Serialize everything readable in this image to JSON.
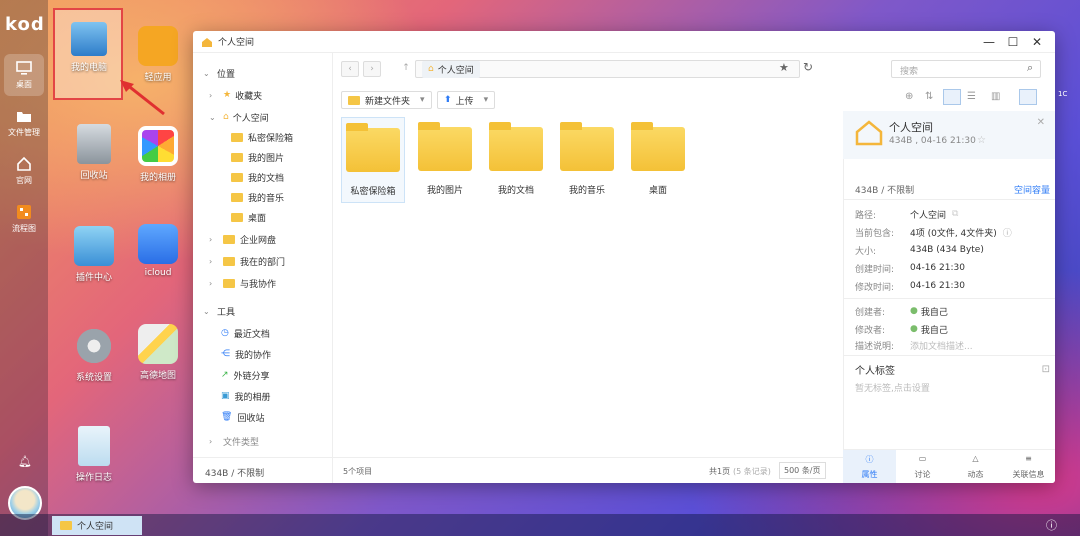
{
  "app": {
    "logo": "kod"
  },
  "left_bar": {
    "items": [
      {
        "label": "桌面",
        "icon": "monitor-icon"
      },
      {
        "label": "文件管理",
        "icon": "folder-icon"
      },
      {
        "label": "官网",
        "icon": "home-icon"
      },
      {
        "label": "流程图",
        "icon": "flowchart-icon"
      }
    ]
  },
  "desktop": {
    "icons": [
      {
        "label": "我的电脑",
        "icon": "computer-icon"
      },
      {
        "label": "轻应用",
        "icon": "shopping-bag-icon"
      },
      {
        "label": "回收站",
        "icon": "trash-icon"
      },
      {
        "label": "我的相册",
        "icon": "photos-icon"
      },
      {
        "label": "插件中心",
        "icon": "plugin-icon"
      },
      {
        "label": "icloud",
        "icon": "cloud-icon"
      },
      {
        "label": "系统设置",
        "icon": "gear-icon"
      },
      {
        "label": "高德地图",
        "icon": "map-icon"
      },
      {
        "label": "操作日志",
        "icon": "notepad-icon"
      }
    ]
  },
  "window": {
    "title": "个人空间",
    "sidebar": {
      "section_location": "位置",
      "favorites": "收藏夹",
      "personal": "个人空间",
      "personal_children": [
        "私密保险箱",
        "我的图片",
        "我的文档",
        "我的音乐",
        "桌面"
      ],
      "enterprise": "企业网盘",
      "my_dept": "我在的部门",
      "collab": "与我协作",
      "section_tools": "工具",
      "tools": [
        "最近文档",
        "我的协作",
        "外链分享",
        "我的相册",
        "回收站"
      ],
      "file_types": "文件类型",
      "footer": "434B / 不限制"
    },
    "toolbar": {
      "path": "个人空间",
      "search_placeholder": "搜索",
      "new_folder": "新建文件夹",
      "upload": "上传"
    },
    "files": [
      "私密保险箱",
      "我的图片",
      "我的文档",
      "我的音乐",
      "桌面"
    ],
    "footer": {
      "count": "5个项目",
      "pages": "共1页",
      "records": "(5 条记录)",
      "per_page": "500 条/页"
    },
    "props": {
      "name": "个人空间",
      "sub": "434B , 04-16 21:30",
      "quota": "434B / 不限制",
      "quota_link": "空间容量",
      "rows": [
        {
          "k": "路径:",
          "v": "个人空间"
        },
        {
          "k": "当前包含:",
          "v": "4项 (0文件, 4文件夹)"
        },
        {
          "k": "大小:",
          "v": "434B (434 Byte)"
        },
        {
          "k": "创建时间:",
          "v": "04-16 21:30"
        },
        {
          "k": "修改时间:",
          "v": "04-16 21:30"
        }
      ],
      "creator_k": "创建者:",
      "creator_v": "我自己",
      "modifier_k": "修改者:",
      "modifier_v": "我自己",
      "desc_k": "描述说明:",
      "desc_placeholder": "添加文档描述...",
      "tag_title": "个人标签",
      "tag_hint": "暂无标签,点击设置",
      "tabs": [
        "属性",
        "讨论",
        "动态",
        "关联信息"
      ]
    }
  },
  "taskbar": {
    "item": "个人空间"
  }
}
